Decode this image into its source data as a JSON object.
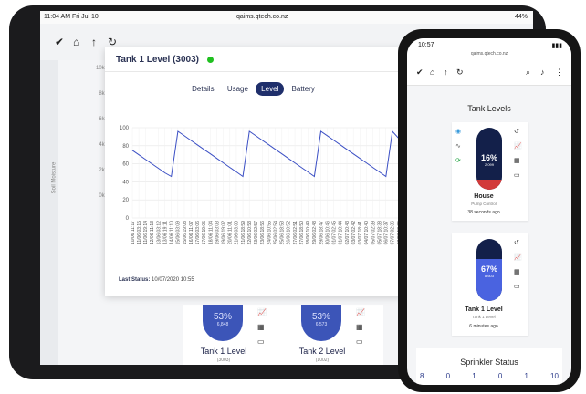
{
  "tablet": {
    "status_time": "11:04 AM  Fri Jul 10",
    "status_url": "qaims.qtech.co.nz",
    "status_battery": "44%",
    "toolbar_icons": [
      "double-check-icon",
      "home-icon",
      "arrow-up-icon",
      "refresh-icon"
    ],
    "bg_axis_ticks": [
      "10kPa",
      "8kPa",
      "6kPa",
      "4kPa",
      "2kPa",
      "0kPa"
    ],
    "bg_axis_label": "Soil Moisture",
    "bg_cards": [
      {
        "percent": "53%",
        "volume": "6,848",
        "name": "Tank 1 Level",
        "sub": "(3003)"
      },
      {
        "percent": "53%",
        "volume": "6,573",
        "name": "Tank 2 Level",
        "sub": "(1002)"
      }
    ]
  },
  "modal": {
    "title": "Tank 1 Level (3003)",
    "status_color": "#20c020",
    "tabs": [
      {
        "label": "Details",
        "active": false
      },
      {
        "label": "Usage",
        "active": false
      },
      {
        "label": "Level",
        "active": true
      },
      {
        "label": "Battery",
        "active": false
      }
    ],
    "last_status_label": "Last Status:",
    "last_status_value": "10/07/2020 10:55"
  },
  "chart_data": {
    "type": "line",
    "title": "",
    "xlabel": "",
    "ylabel": "",
    "ylim": [
      0,
      100
    ],
    "yticks": [
      0,
      20,
      40,
      60,
      80,
      100
    ],
    "grid": true,
    "color": "#3b4fc4",
    "categories": [
      "10/06 11:17",
      "11/06 03:15",
      "11/06 19:14",
      "12/06 11:13",
      "13/06 03:12",
      "13/06 19:11",
      "14/06 11:10",
      "15/06 03:09",
      "15/06 19:08",
      "16/06 11:07",
      "17/06 03:06",
      "17/06 19:05",
      "18/06 11:04",
      "19/06 03:03",
      "19/06 19:02",
      "20/06 11:01",
      "21/06 03:00",
      "21/06 18:59",
      "22/06 10:58",
      "23/06 02:57",
      "23/06 18:56",
      "24/06 10:55",
      "25/06 02:54",
      "25/06 18:53",
      "26/06 10:52",
      "27/06 02:51",
      "27/06 18:50",
      "28/06 10:49",
      "29/06 02:48",
      "29/06 18:47",
      "30/06 10:46",
      "01/07 02:45",
      "01/07 18:44",
      "02/07 10:43",
      "03/07 02:42",
      "03/07 18:41",
      "04/07 10:40",
      "05/07 02:39",
      "05/07 18:38",
      "06/07 10:37",
      "07/07 02:36",
      "07/07 18:35"
    ],
    "values": [
      75,
      70,
      65,
      60,
      55,
      50,
      46,
      96,
      91,
      86,
      81,
      76,
      71,
      66,
      61,
      56,
      51,
      46,
      96,
      91,
      86,
      81,
      76,
      71,
      66,
      61,
      56,
      51,
      46,
      96,
      91,
      86,
      81,
      76,
      71,
      66,
      61,
      56,
      51,
      46,
      96,
      88
    ]
  },
  "phone": {
    "status_time": "10:57",
    "url": "qaims.qtech.co.nz",
    "toolbar_icons": [
      "double-check-icon",
      "home-icon",
      "arrow-up-icon",
      "refresh-icon",
      "search-icon",
      "bell-icon",
      "more-icon"
    ],
    "section_title": "Tank Levels",
    "cards": [
      {
        "percent": "16%",
        "volume": "2,099",
        "fill": 0.16,
        "fill_color": "#d23a3a",
        "name": "House",
        "sub": "Pump Control",
        "time": "38 seconds ago"
      },
      {
        "percent": "67%",
        "volume": "8,603",
        "fill": 0.67,
        "fill_color": "#4a63e0",
        "name": "Tank 1 Level",
        "sub": "Tank 1 Level",
        "time": "6 minutes ago"
      }
    ],
    "sprinkler_title": "Sprinkler Status",
    "sprinkler_counts": [
      "8",
      "0",
      "1",
      "0",
      "1",
      "10"
    ]
  }
}
